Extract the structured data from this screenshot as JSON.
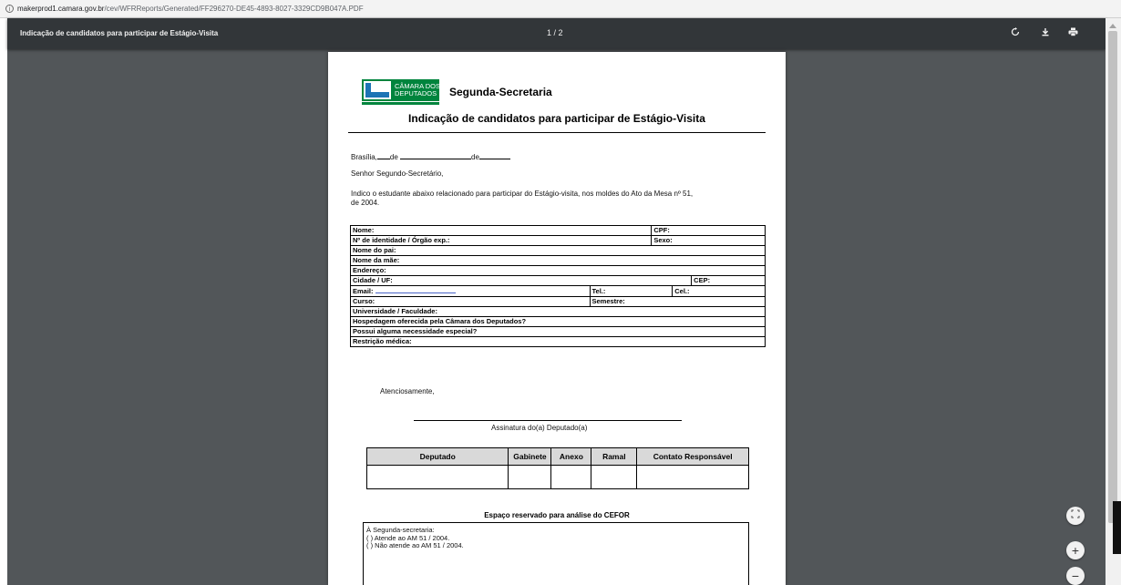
{
  "browser": {
    "url_host": "makerprod1.camara.gov.br",
    "url_path": "/cev/WFRReports/Generated/FF296270-DE45-4893-8027-3329CD9B047A.PDF"
  },
  "viewer": {
    "title": "Indicação de candidatos para participar de Estágio-Visita",
    "page_indicator": "1 / 2",
    "zoom_in": "+",
    "zoom_out": "−"
  },
  "document": {
    "logo": {
      "line1": "CÂMARA DOS",
      "line2": "DEPUTADOS"
    },
    "secretaria": "Segunda-Secretaria",
    "form_title": "Indicação de candidatos para participar de Estágio-Visita",
    "date": {
      "city": "Brasília,",
      "de1": "de",
      "de2": "de"
    },
    "greeting": "Senhor Segundo-Secretário,",
    "intro_line1": "Indico o estudante abaixo relacionado para participar do Estágio-visita, nos moldes do Ato da Mesa nº 51,",
    "intro_line2": "de 2004.",
    "fields": {
      "nome": "Nome:",
      "cpf": "CPF:",
      "identidade": "Nº de identidade / Órgão exp.:",
      "sexo": "Sexo:",
      "pai": "Nome do pai:",
      "mae": "Nome da mãe:",
      "endereco": "Endereço:",
      "cidade": "Cidade / UF:",
      "cep": "CEP:",
      "email": "Email:",
      "tel": "Tel.:",
      "cel": "Cel.:",
      "curso": "Curso:",
      "semestre": "Semestre:",
      "universidade": "Universidade / Faculdade:",
      "hospedagem": "Hospedagem oferecida pela Câmara dos Deputados?",
      "necessidade": "Possui alguma necessidade especial?",
      "restricao": "Restrição médica:"
    },
    "closing": "Atenciosamente,",
    "signature": "Assinatura do(a) Deputado(a)",
    "deputy_table": {
      "headers": [
        "Deputado",
        "Gabinete",
        "Anexo",
        "Ramal",
        "Contato Responsável"
      ]
    },
    "cefor": {
      "title": "Espaço reservado para análise do CEFOR",
      "line1": "À Segunda-secretaria:",
      "line2": "( ) Atende ao AM 51 / 2004.",
      "line3": "( ) Não atende ao AM 51 / 2004."
    }
  }
}
